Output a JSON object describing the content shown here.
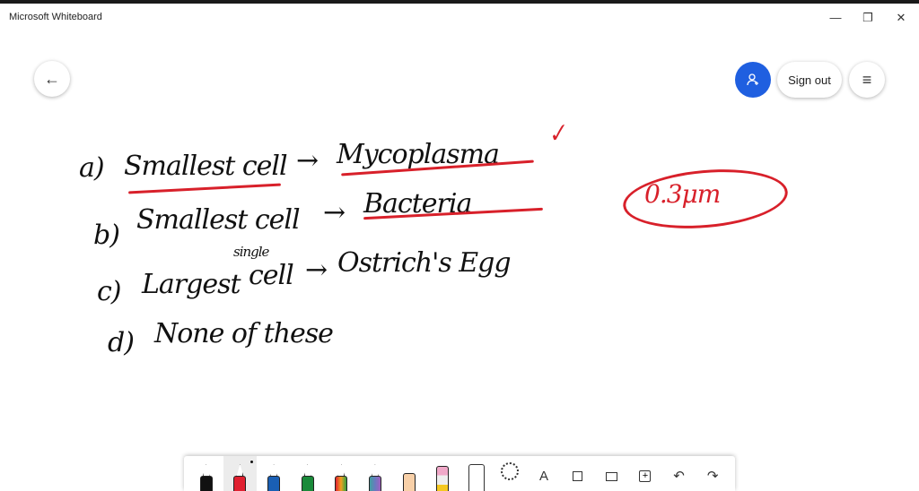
{
  "window": {
    "title": "Microsoft Whiteboard",
    "minimize": "—",
    "restore": "❐",
    "close": "✕"
  },
  "header": {
    "back_icon": "←",
    "account_icon": "person-add",
    "sign_out": "Sign out",
    "menu_icon": "≡"
  },
  "canvas": {
    "lines": [
      {
        "label": "a)",
        "text": "Smallest cell",
        "arrow": "→",
        "answer": "Mycoplasma"
      },
      {
        "label": "b)",
        "text": "Smallest cell",
        "arrow": "→",
        "answer": "Bacteria"
      },
      {
        "label": "c)",
        "text": "Largest",
        "annotation": "single",
        "text2": "cell",
        "arrow": "→",
        "answer": "Ostrich's Egg"
      },
      {
        "label": "d)",
        "text": "None of these"
      }
    ],
    "check": "✓",
    "size_note": "0.3μm"
  },
  "toolbar": {
    "pens": [
      {
        "name": "black-pen",
        "color": "#111111"
      },
      {
        "name": "red-pen",
        "color": "#e02030"
      },
      {
        "name": "blue-pen",
        "color": "#1a5fb4"
      },
      {
        "name": "green-pen",
        "color": "#1a8a3a"
      },
      {
        "name": "rainbow-pen",
        "color": "#e07020"
      },
      {
        "name": "galaxy-pen",
        "color": "#6a7ac0"
      },
      {
        "name": "highlighter",
        "color": "#f8d0a8"
      },
      {
        "name": "eraser",
        "color": "#f0a8c8"
      }
    ],
    "text_tool": "A",
    "undo": "↶",
    "redo": "↷"
  }
}
